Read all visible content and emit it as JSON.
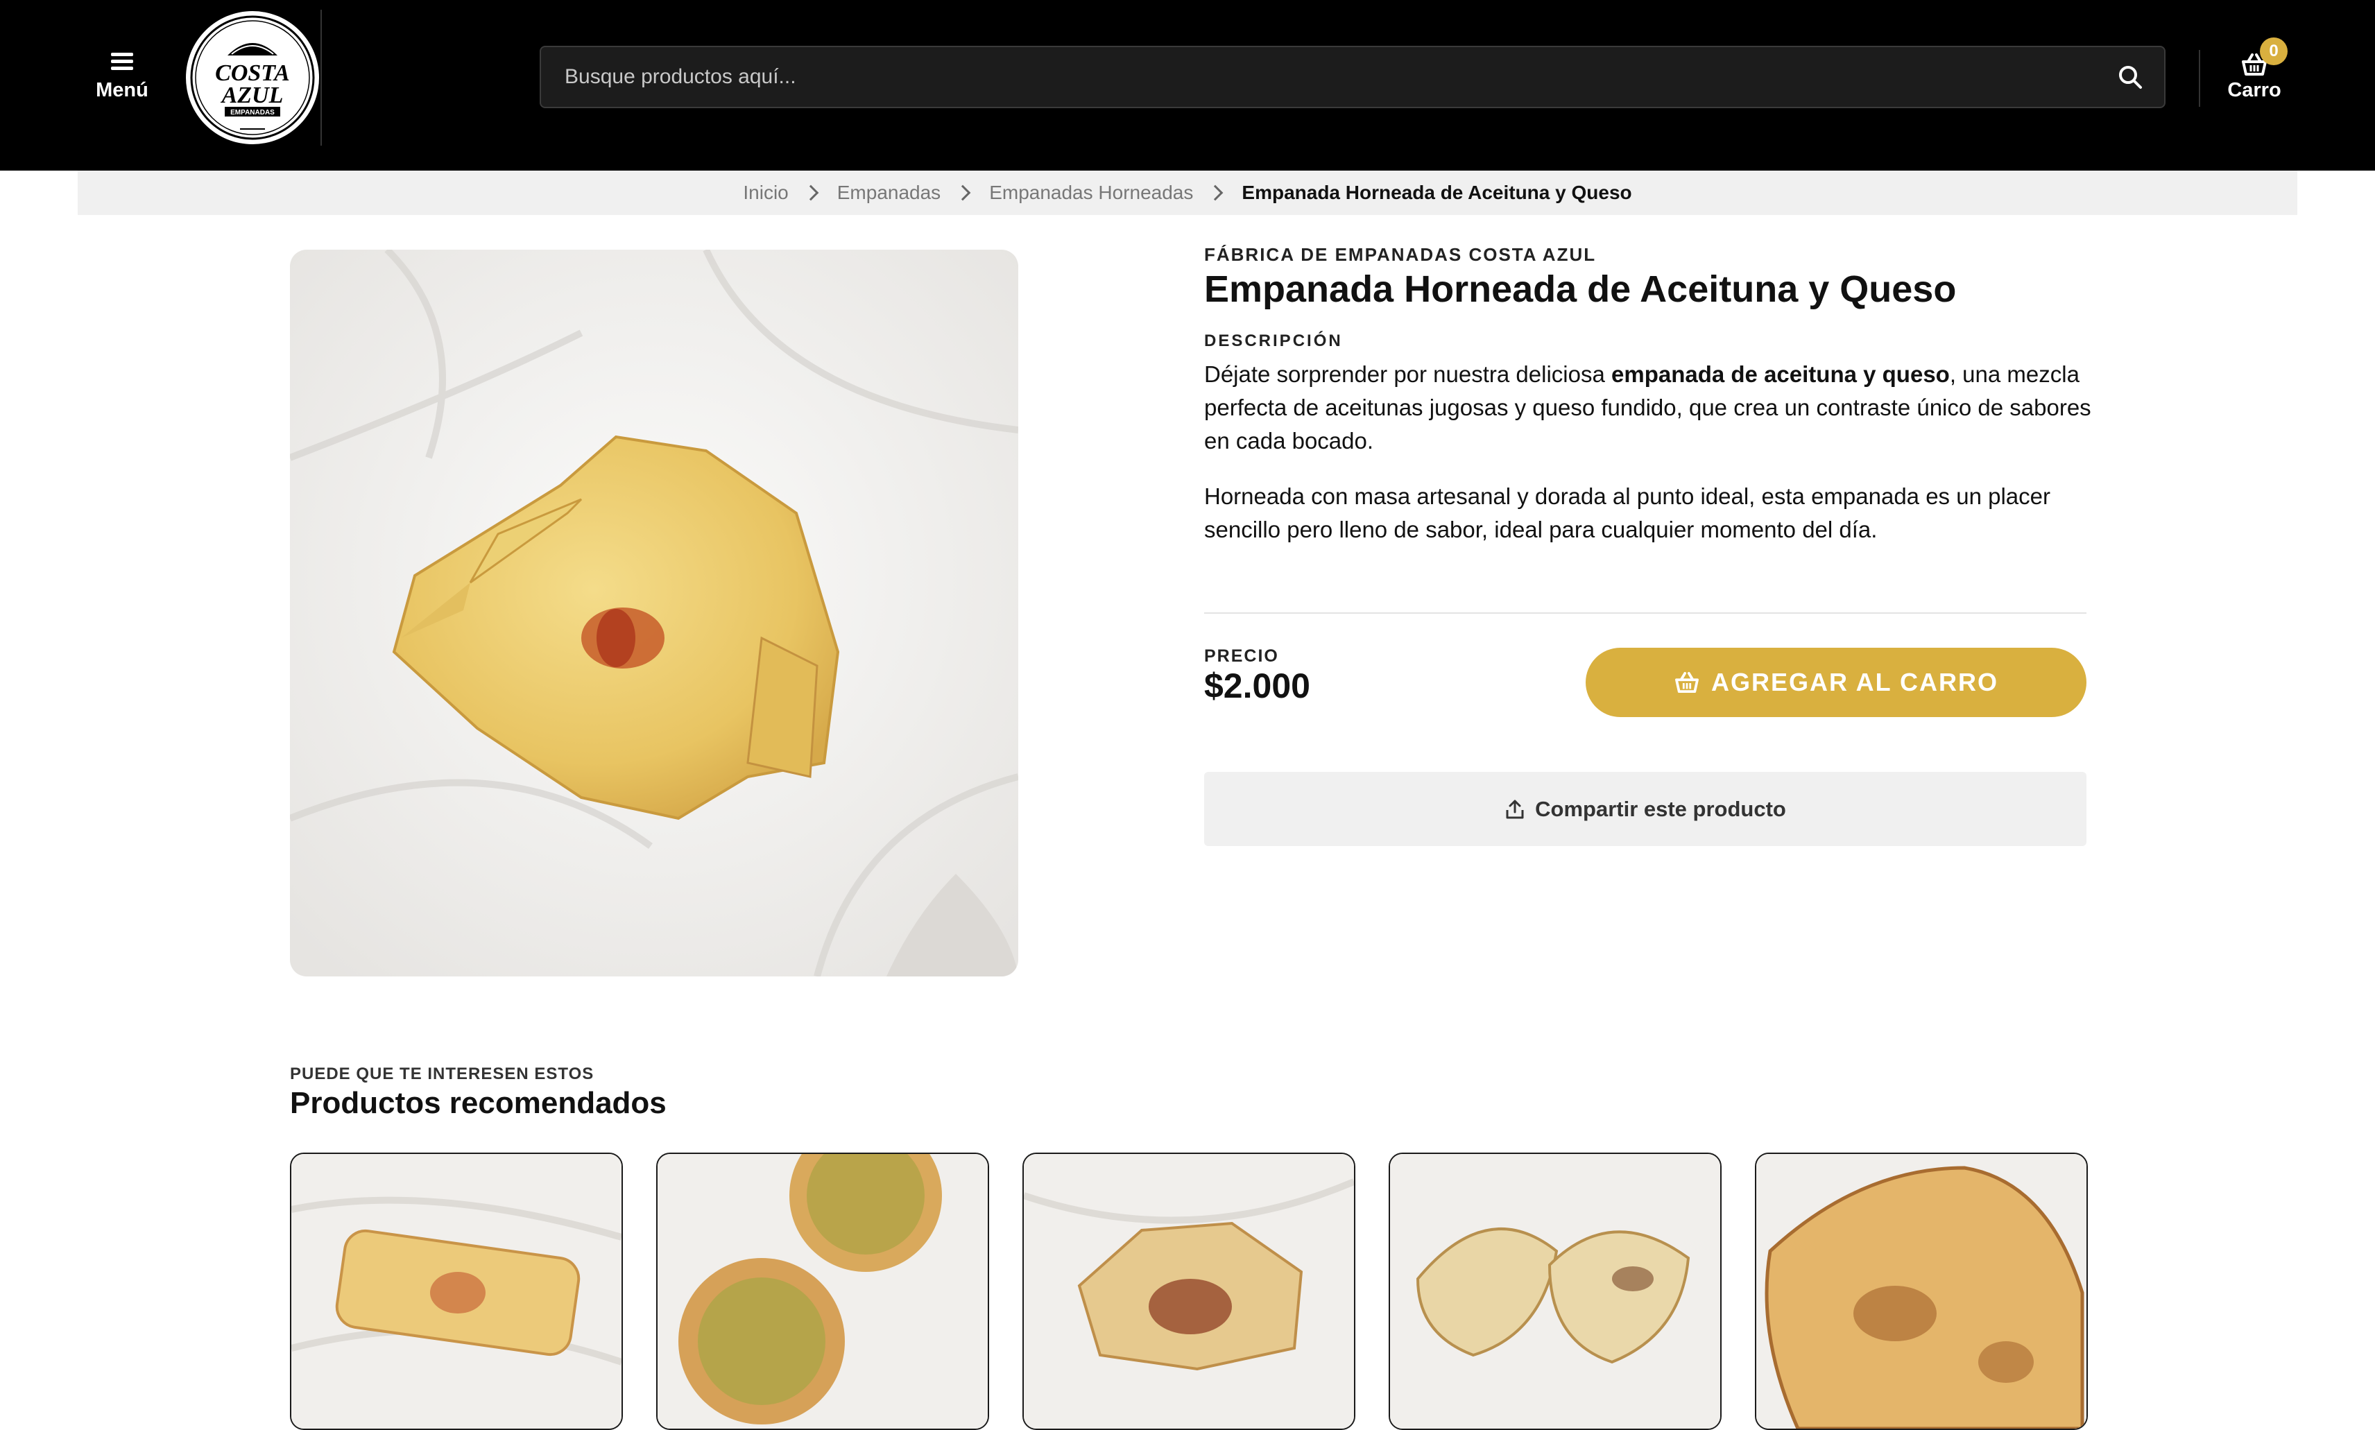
{
  "header": {
    "menu_label": "Menú",
    "logo": {
      "line1": "COSTA",
      "line2": "AZUL",
      "ribbon": "EMPANADAS"
    },
    "search_placeholder": "Busque productos aquí...",
    "cart_label": "Carro",
    "cart_count": "0"
  },
  "breadcrumb": [
    "Inicio",
    "Empanadas",
    "Empanadas Horneadas",
    "Empanada Horneada de Aceituna y Queso"
  ],
  "product": {
    "brand": "FÁBRICA DE EMPANADAS COSTA AZUL",
    "title": "Empanada Horneada de Aceituna y Queso",
    "description_label": "DESCRIPCIÓN",
    "desc_p1_before": "Déjate sorprender por nuestra deliciosa ",
    "desc_p1_bold": "empanada de aceituna y queso",
    "desc_p1_after": ", una mezcla perfecta de aceitunas jugosas y queso fundido, que crea un contraste único de sabores en cada bocado.",
    "desc_p2": "Horneada con masa artesanal y dorada al punto ideal, esta empanada es un placer sencillo pero lleno de sabor, ideal para cualquier momento del día.",
    "price_label": "PRECIO",
    "price": "$2.000",
    "add_to_cart": "AGREGAR AL CARRO",
    "share": "Compartir este producto"
  },
  "recommended": {
    "kicker": "PUEDE QUE TE INTERESEN ESTOS",
    "title": "Productos recomendados"
  },
  "colors": {
    "header_bg": "#000000",
    "accent": "#d9b03f",
    "breadcrumb_bg": "#f0f0f0"
  }
}
